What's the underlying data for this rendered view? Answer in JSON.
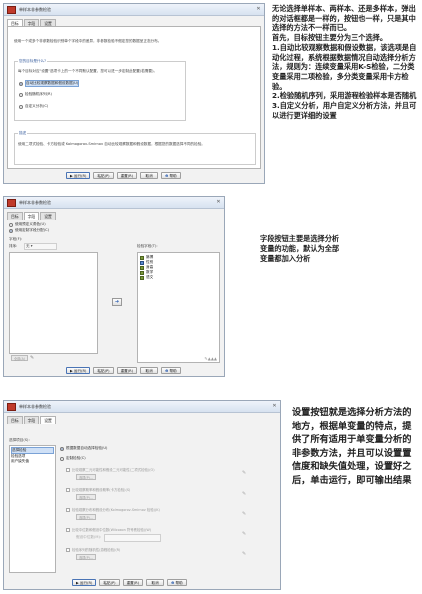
{
  "dialog1": {
    "title": "单样本非参数检验",
    "tabs": [
      "目标",
      "字段",
      "设置"
    ],
    "intro": "使用一个或多个非参数检验识别单个字段中的差异，非参数检验不假定您的数据呈正态分布。",
    "group_label": "您的目标是什么?",
    "group_sub": "每个目标对应\"设置\"选项卡上的一个不同默认配置，您可以进一步定制此配置(若需要)。",
    "options": [
      "自动比较观察数据和假设数据(U)",
      "检验随机序列(R)",
      "自定义分析(C)"
    ],
    "desc_label": "描述",
    "desc_text": "使用二项式检验、卡方检验或 Kolmogorov-Smirnov 自动比较观察数据和假设数据，根据您的数据选择不同的检验。",
    "buttons": [
      "运行(R)",
      "粘贴(P)",
      "重置(R)",
      "取消",
      "帮助"
    ]
  },
  "note1": [
    "无论选择单样本、两样本、还是多样本，弹出的对话框都是一样的，按钮也一样，只是其中选择的方法不一样而已。",
    "首先，目标按钮主要分为三个选择。",
    "1.自动比较观察数据和假设数据，该选项是自动化过程，系统根据数据情况自动选择分析方法，规则为：连续变量采用K-S检验，二分类变量采用二项检验，多分类变量采用卡方检验。",
    "2.检验随机序列，采用游程检验样本是否随机",
    "3.自定义分析，用户自定义分析方法，并且可以进行更详细的设置"
  ],
  "dialog2": {
    "title": "单样本非参数检验",
    "tabs": [
      "目标",
      "字段",
      "设置"
    ],
    "radio1": "使用预定义角色(U)",
    "radio2": "使用定制字段分配(C)",
    "fields_label": "字段(F):",
    "sort_label": "排序:",
    "sort_value": "无",
    "test_fields_label": "检验字段(T):",
    "test_fields": [
      "脉搏",
      "性别",
      "身高",
      "数学",
      "语文"
    ],
    "arrow": "➜",
    "buttons": [
      "运行(R)",
      "粘贴(P)",
      "重置(R)",
      "取消",
      "帮助"
    ]
  },
  "note2": "字段按钮主要是选择分析变量的功能，默认为全部变量都加入分析",
  "dialog3": {
    "title": "单样本非参数检验",
    "tabs": [
      "目标",
      "字段",
      "设置"
    ],
    "select_item_label": "选择项目(S):",
    "items": [
      "选择检验",
      "检验选项",
      "用户缺失值"
    ],
    "radio1": "根据数据自动选择检验(U)",
    "radio2": "定制检验(C)",
    "tests": [
      "比较观察二元可能性和假设二元可能性(二项式检验)(O)",
      "比较观察概率和假设概率(卡方检验)(S)",
      "检验观察分布和假设分布(Kolmogorov-Smirnov 检验)(K)",
      "比较中位数和假设中位数(Wilcoxon 符号秩检验)(W)",
      "检验序列的随机性(游程检验)(R)"
    ],
    "option_button": "选项(P)...",
    "median_label": "假设中位数(M):",
    "buttons": [
      "运行(R)",
      "粘贴(P)",
      "重置(R)",
      "取消",
      "帮助"
    ]
  },
  "note3": "设置按钮就是选择分析方法的地方，根据单变量的特点，提供了所有适用于单变量分析的非参数方法，并且可以设置置信度和缺失值处理，设置好之后，单击运行，即可输出结果"
}
